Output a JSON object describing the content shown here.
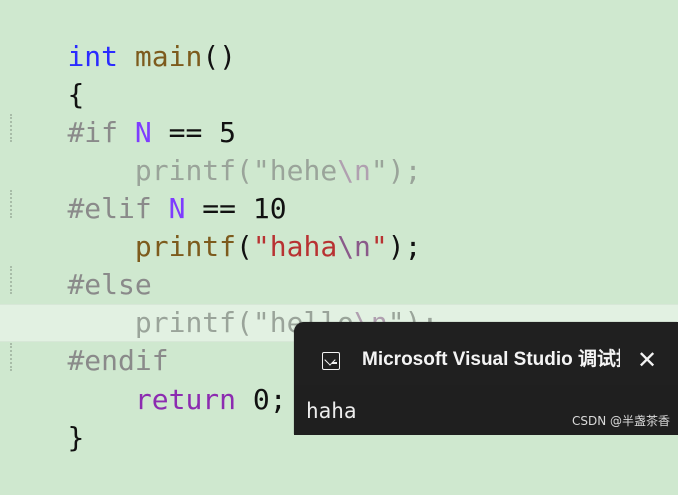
{
  "editor": {
    "lines": [
      [
        {
          "text": "int",
          "style": "kw"
        },
        {
          "text": " ",
          "style": "plain"
        },
        {
          "text": "main",
          "style": "fn"
        },
        {
          "text": "()",
          "style": "plain"
        }
      ],
      [
        {
          "text": "{",
          "style": "plain"
        }
      ],
      [
        {
          "text": "#if",
          "style": "macro-muted"
        },
        {
          "text": " ",
          "style": "plain"
        },
        {
          "text": "N",
          "style": "macro-id"
        },
        {
          "text": " == 5",
          "style": "plain"
        }
      ],
      [
        {
          "text": "    ",
          "style": "plain"
        },
        {
          "text": "printf",
          "style": "muted"
        },
        {
          "text": "(",
          "style": "muted"
        },
        {
          "text": "\"hehe",
          "style": "muted"
        },
        {
          "text": "\\n",
          "style": "muted-esc"
        },
        {
          "text": "\");",
          "style": "muted"
        }
      ],
      [
        {
          "text": "#elif",
          "style": "macro-muted"
        },
        {
          "text": " ",
          "style": "plain"
        },
        {
          "text": "N",
          "style": "macro-id"
        },
        {
          "text": " == 10",
          "style": "plain"
        }
      ],
      [
        {
          "text": "    ",
          "style": "plain"
        },
        {
          "text": "printf",
          "style": "fn"
        },
        {
          "text": "(",
          "style": "plain"
        },
        {
          "text": "\"haha",
          "style": "str"
        },
        {
          "text": "\\n",
          "style": "esc"
        },
        {
          "text": "\"",
          "style": "str"
        },
        {
          "text": ");",
          "style": "plain"
        }
      ],
      [
        {
          "text": "#else",
          "style": "macro-muted"
        }
      ],
      [
        {
          "text": "    ",
          "style": "plain"
        },
        {
          "text": "printf",
          "style": "muted"
        },
        {
          "text": "(",
          "style": "muted"
        },
        {
          "text": "\"hello",
          "style": "muted"
        },
        {
          "text": "\\n",
          "style": "muted-esc"
        },
        {
          "text": "\");",
          "style": "muted"
        }
      ],
      [
        {
          "text": "#endif",
          "style": "macro-muted"
        }
      ],
      [
        {
          "text": "    ",
          "style": "plain"
        },
        {
          "text": "return",
          "style": "kw-purple"
        },
        {
          "text": " 0;",
          "style": "plain"
        }
      ],
      [
        {
          "text": "}",
          "style": "plain"
        }
      ]
    ]
  },
  "console": {
    "title": "Microsoft Visual Studio 调试控",
    "close_icon": "close-icon",
    "terminal_icon": "terminal-icon",
    "output": "haha"
  },
  "watermark": "CSDN @半盏茶香",
  "colors": {
    "editor_background": "#cfe8cf",
    "current_line_background": "#e2f1e2",
    "console_background": "#1f1f1f",
    "keyword": "#2b2bff",
    "function": "#7d5b1d",
    "string": "#b83232",
    "macro_identifier": "#7e3cff"
  }
}
